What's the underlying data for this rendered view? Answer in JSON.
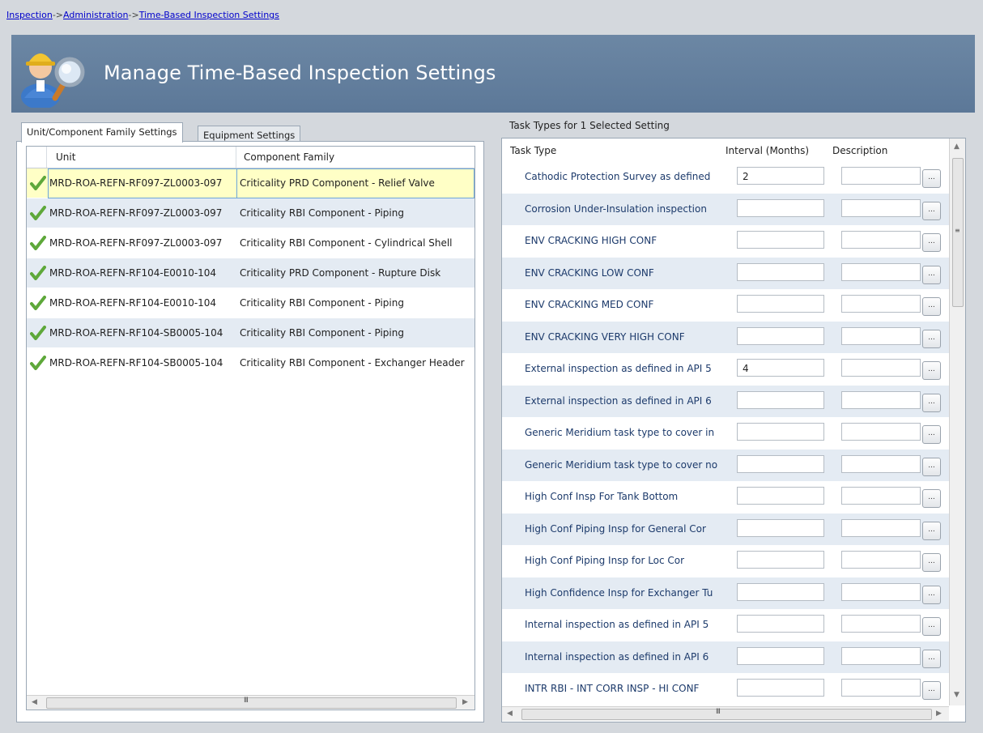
{
  "breadcrumb": [
    "Inspection",
    "Administration",
    "Time-Based Inspection Settings"
  ],
  "breadcrumb_sep": "->",
  "header": {
    "title": "Manage Time-Based Inspection Settings",
    "icon": "inspector-magnifier-icon"
  },
  "tabs": [
    "Unit/Component Family Settings",
    "Equipment Settings"
  ],
  "left_grid": {
    "columns": [
      "Unit",
      "Component Family"
    ],
    "rows": [
      {
        "unit": "MRD-ROA-REFN-RF097-ZL0003-097",
        "family": "Criticality PRD Component - Relief Valve",
        "selected": true
      },
      {
        "unit": "MRD-ROA-REFN-RF097-ZL0003-097",
        "family": "Criticality RBI Component - Piping"
      },
      {
        "unit": "MRD-ROA-REFN-RF097-ZL0003-097",
        "family": "Criticality RBI Component - Cylindrical Shell"
      },
      {
        "unit": "MRD-ROA-REFN-RF104-E0010-104",
        "family": "Criticality PRD Component - Rupture Disk"
      },
      {
        "unit": "MRD-ROA-REFN-RF104-E0010-104",
        "family": "Criticality RBI Component - Piping"
      },
      {
        "unit": "MRD-ROA-REFN-RF104-SB0005-104",
        "family": "Criticality RBI Component - Piping"
      },
      {
        "unit": "MRD-ROA-REFN-RF104-SB0005-104",
        "family": "Criticality RBI Component - Exchanger Header"
      }
    ]
  },
  "right": {
    "caption": "Task Types for 1 Selected Setting",
    "columns": [
      "Task Type",
      "Interval (Months)",
      "Description"
    ],
    "button_label": "...",
    "rows": [
      {
        "type": "Cathodic Protection Survey as defined",
        "interval": "2"
      },
      {
        "type": "Corrosion Under-Insulation inspection",
        "interval": ""
      },
      {
        "type": "ENV CRACKING  HIGH CONF",
        "interval": ""
      },
      {
        "type": "ENV CRACKING  LOW CONF",
        "interval": ""
      },
      {
        "type": "ENV CRACKING  MED CONF",
        "interval": ""
      },
      {
        "type": "ENV CRACKING VERY HIGH CONF",
        "interval": ""
      },
      {
        "type": "External inspection as defined in API 5",
        "interval": "4"
      },
      {
        "type": "External inspection as defined in API 6",
        "interval": ""
      },
      {
        "type": "Generic Meridium task type to cover in",
        "interval": ""
      },
      {
        "type": "Generic Meridium task type to cover no",
        "interval": ""
      },
      {
        "type": "High Conf Insp For Tank Bottom",
        "interval": ""
      },
      {
        "type": "High Conf Piping Insp for General Cor",
        "interval": ""
      },
      {
        "type": "High Conf Piping Insp for Loc Cor",
        "interval": ""
      },
      {
        "type": "High Confidence Insp for Exchanger Tu",
        "interval": ""
      },
      {
        "type": "Internal inspection as defined in API 5",
        "interval": ""
      },
      {
        "type": "Internal inspection as defined in API 6",
        "interval": ""
      },
      {
        "type": "INTR RBI - INT CORR INSP - HI CONF",
        "interval": ""
      }
    ]
  },
  "scroll_grip": "III"
}
